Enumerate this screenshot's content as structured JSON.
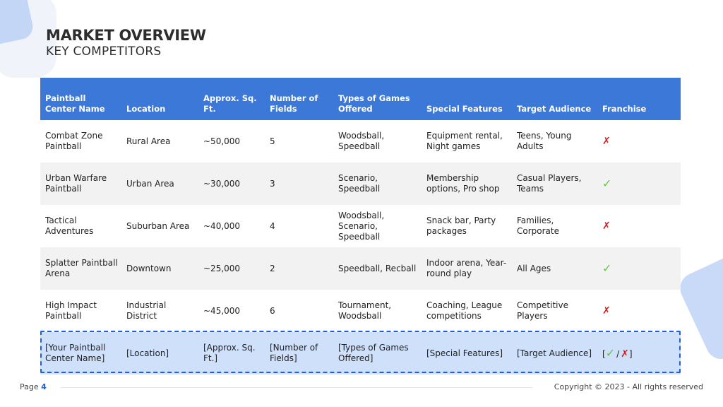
{
  "header": {
    "title": "MARKET OVERVIEW",
    "subtitle": "KEY COMPETITORS"
  },
  "table": {
    "columns": [
      "Paintball Center Name",
      "Location",
      "Approx. Sq. Ft.",
      "Number of Fields",
      "Types of Games Offered",
      "Special Features",
      "Target Audience",
      "Franchise"
    ],
    "rows": [
      {
        "name": "Combat Zone Paintball",
        "location": "Rural Area",
        "sqft": "~50,000",
        "fields": "5",
        "games": "Woodsball, Speedball",
        "features": "Equipment rental, Night games",
        "audience": "Teens, Young Adults",
        "franchise": "✗"
      },
      {
        "name": "Urban Warfare Paintball",
        "location": "Urban Area",
        "sqft": "~30,000",
        "fields": "3",
        "games": "Scenario, Speedball",
        "features": "Membership options, Pro shop",
        "audience": "Casual Players, Teams",
        "franchise": "✓"
      },
      {
        "name": "Tactical Adventures",
        "location": "Suburban Area",
        "sqft": "~40,000",
        "fields": "4",
        "games": "Woodsball, Scenario, Speedball",
        "features": "Snack bar, Party packages",
        "audience": "Families, Corporate",
        "franchise": "✗"
      },
      {
        "name": "Splatter Paintball Arena",
        "location": "Downtown",
        "sqft": "~25,000",
        "fields": "2",
        "games": "Speedball, Recball",
        "features": "Indoor arena, Year-round play",
        "audience": "All Ages",
        "franchise": "✓"
      },
      {
        "name": "High Impact Paintball",
        "location": "Industrial District",
        "sqft": "~45,000",
        "fields": "6",
        "games": "Tournament, Woodsball",
        "features": "Coaching, League competitions",
        "audience": "Competitive Players",
        "franchise": "✗"
      }
    ],
    "template_row": {
      "name": "[Your Paintball Center Name]",
      "location": "[Location]",
      "sqft": "[Approx. Sq. Ft.]",
      "fields": "[Number of Fields]",
      "games": "[Types of Games Offered]",
      "features": "[Special Features]",
      "audience": "[Target Audience]",
      "franchise_open": "[",
      "franchise_yes": "✓",
      "franchise_sep": "/",
      "franchise_no": "✗",
      "franchise_close": "]"
    }
  },
  "footer": {
    "page_label": "Page",
    "page_number": "4",
    "copyright": "Copyright © 2023 - All rights reserved"
  },
  "colors": {
    "header_bg": "#3c78d8",
    "alt_row_bg": "#f2f2f2",
    "template_row_bg": "#cfe0fb",
    "dashed_border": "#1c5fd8",
    "check": "#6cc24a",
    "cross": "#d11f1f"
  }
}
